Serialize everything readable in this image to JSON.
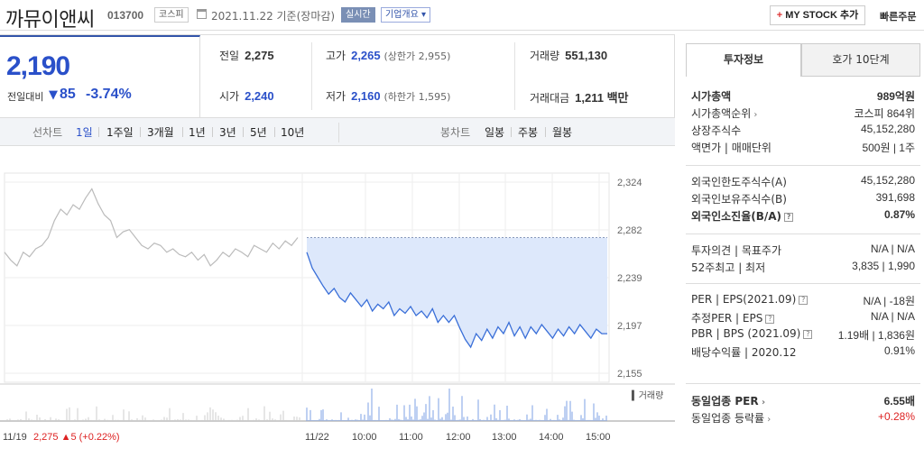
{
  "header": {
    "name": "까뮤이앤씨",
    "code": "013700",
    "market": "코스피",
    "date": "2021.11.22 기준(장마감)",
    "live": "실시간",
    "corp": "기업개요",
    "mystock": "MY STOCK 추가",
    "quick_order": "빠른주문"
  },
  "price": {
    "current": "2,190",
    "change_label": "전일대비",
    "change": "85",
    "change_pct": "-3.74%",
    "prev_label": "전일",
    "prev": "2,275",
    "high_label": "고가",
    "high": "2,265",
    "upper_limit": "(상한가 2,955)",
    "volume_label": "거래량",
    "volume": "551,130",
    "open_label": "시가",
    "open": "2,240",
    "low_label": "저가",
    "low": "2,160",
    "lower_limit": "(하한가 1,595)",
    "amount_label": "거래대금",
    "amount": "1,211 백만"
  },
  "tabs": {
    "line_label": "선차트",
    "line": [
      "1일",
      "1주일",
      "3개월",
      "1년",
      "3년",
      "5년",
      "10년"
    ],
    "candle_label": "봉차트",
    "candle": [
      "일봉",
      "주봉",
      "월봉"
    ]
  },
  "chart_data": {
    "type": "line",
    "y_ticks": [
      "2,324",
      "2,282",
      "2,239",
      "2,197",
      "2,155"
    ],
    "ylim": [
      2155,
      2324
    ],
    "prev_close": 2275,
    "x_labels": [
      "11/19",
      "11/22",
      "10:00",
      "11:00",
      "12:00",
      "13:00",
      "14:00",
      "15:00"
    ],
    "prev_day_label": "11/19",
    "prev_day_close": "2,275",
    "prev_day_change": "▲5 (+0.22%)",
    "volume_label": "거래량",
    "prev_series": [
      2262,
      2255,
      2250,
      2262,
      2258,
      2265,
      2268,
      2275,
      2290,
      2300,
      2295,
      2304,
      2300,
      2310,
      2318,
      2305,
      2295,
      2290,
      2275,
      2280,
      2282,
      2275,
      2268,
      2265,
      2270,
      2268,
      2262,
      2265,
      2260,
      2258,
      2262,
      2255,
      2260,
      2250,
      2255,
      2262,
      2258,
      2265,
      2262,
      2258,
      2268,
      2265,
      2262,
      2270,
      2265,
      2272,
      2268,
      2275
    ],
    "today_series": [
      2262,
      2248,
      2240,
      2232,
      2225,
      2230,
      2222,
      2218,
      2226,
      2220,
      2214,
      2220,
      2210,
      2216,
      2212,
      2218,
      2206,
      2212,
      2208,
      2214,
      2206,
      2210,
      2204,
      2212,
      2200,
      2206,
      2200,
      2206,
      2195,
      2185,
      2178,
      2190,
      2184,
      2194,
      2186,
      2196,
      2190,
      2200,
      2188,
      2196,
      2186,
      2196,
      2190,
      2198,
      2192,
      2186,
      2194,
      2188,
      2196,
      2190,
      2198,
      2192,
      2186,
      2194,
      2190,
      2190
    ]
  },
  "invest": {
    "tab1": "투자정보",
    "tab2": "호가 10단계",
    "rows1": [
      {
        "k": "시가총액",
        "v": "989억원",
        "bold": true
      },
      {
        "k": "시가총액순위",
        "v": "코스피 864위"
      },
      {
        "k": "상장주식수",
        "v": "45,152,280"
      },
      {
        "k": "액면가 | 매매단위",
        "v": "500원 | 1주"
      }
    ],
    "rows2": [
      {
        "k": "외국인한도주식수(A)",
        "v": "45,152,280"
      },
      {
        "k": "외국인보유주식수(B)",
        "v": "391,698"
      },
      {
        "k": "외국인소진율(B/A)",
        "v": "0.87%",
        "bold": true
      }
    ],
    "rows3": [
      {
        "k": "투자의견 | 목표주가",
        "v": "N/A | N/A"
      },
      {
        "k": "52주최고 | 최저",
        "v": "3,835 | 1,990"
      }
    ],
    "rows4": [
      {
        "k": "PER | EPS(2021.09)",
        "v": "N/A | -18원"
      },
      {
        "k": "추정PER | EPS",
        "v": "N/A | N/A"
      },
      {
        "k": "PBR | BPS (2021.09)",
        "v": "1.19배 | 1,836원"
      },
      {
        "k": "배당수익률 | 2020.12",
        "v": "0.91%"
      }
    ],
    "rows5": [
      {
        "k": "동일업종 PER",
        "v": "6.55배",
        "bold": true
      },
      {
        "k": "동일업종 등락률",
        "v": "+0.28%"
      }
    ]
  }
}
